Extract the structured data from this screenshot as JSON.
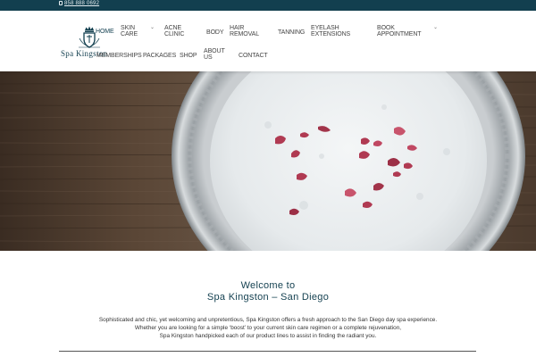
{
  "topbar": {
    "phone": "858 888 0692",
    "phone_icon": "phone-icon",
    "background": "#123f4f"
  },
  "logo": {
    "brand": "Spa Kingston",
    "emblem_icon": "crown-shield-icon",
    "color": "#123f4f"
  },
  "nav": {
    "home": "HOME",
    "skin_care": [
      "SKIN",
      "CARE"
    ],
    "acne_clinic": [
      "ACNE",
      "CLINIC"
    ],
    "body": "BODY",
    "hair_removal": [
      "HAIR",
      "REMOVAL"
    ],
    "tanning": "TANNING",
    "eyelash_extensions": [
      "EYELASH",
      "EXTENSIONS"
    ],
    "book_appointment": [
      "BOOK",
      "APPOINTMENT"
    ],
    "memberships": "MEMBERSHIPS",
    "packages": "PACKAGES",
    "shop": "SHOP",
    "about_us": [
      "ABOUT",
      "US"
    ],
    "contact": "CONTACT",
    "dropdown_icon": "chevron-down-icon"
  },
  "hero": {
    "image": "silver bowl of milk with rose petals on dark wood"
  },
  "welcome": {
    "line1": "Welcome to",
    "line2": "Spa Kingston – San Diego"
  },
  "intro": {
    "line1": "Sophisticated and chic, yet welcoming and unpretentious, Spa Kingston offers a fresh approach to the San Diego day spa experience.",
    "line2": "Whether you are looking for a simple ‘boost’ to your current skin care regimen or a complete rejuvenation,",
    "line3": "Spa Kingston handpicked each of our product lines to assist in finding the radiant you."
  },
  "colors": {
    "accent": "#123f4f",
    "text": "#333333"
  }
}
